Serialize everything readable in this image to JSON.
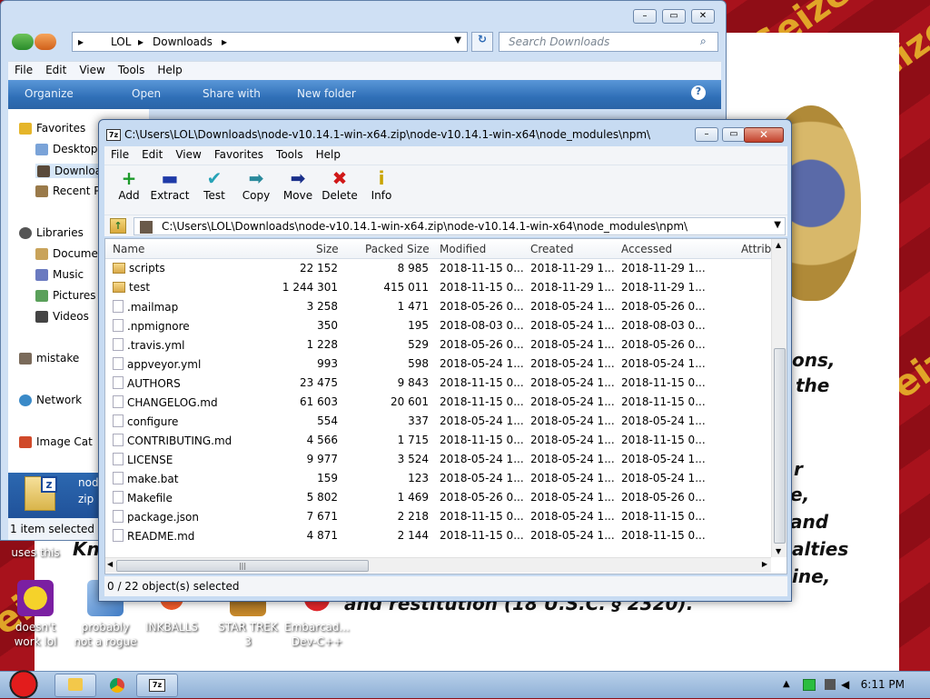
{
  "background": {
    "watermark_text": "Seized",
    "legal_lines": [
      "ons,",
      "the",
      "r",
      "e,",
      "and",
      "alties",
      "ine,",
      "and restitution (18 U.S.C. § 2320)."
    ],
    "partial_text_left": "Kn"
  },
  "desktop_icons": [
    {
      "label": "uses this"
    },
    {
      "label": "doesn't work lol"
    },
    {
      "label": "probably not a rogue"
    },
    {
      "label": "INKBALLS"
    },
    {
      "label": "STAR TREK 3"
    },
    {
      "label": "Embarcad... Dev-C++"
    }
  ],
  "explorer": {
    "breadcrumb": [
      "LOL",
      "Downloads"
    ],
    "search_placeholder": "Search Downloads",
    "menu": [
      "File",
      "Edit",
      "View",
      "Tools",
      "Help"
    ],
    "commands": [
      "Organize",
      "Open",
      "Share with",
      "New folder"
    ],
    "nav": [
      "Favorites",
      "Desktop",
      "Downloads",
      "Recent P",
      "Libraries",
      "Docume",
      "Music",
      "Pictures",
      "Videos",
      "mistake",
      "Network",
      "Image Cat"
    ],
    "detail_name": "node",
    "detail_type": "zip",
    "status": "1 item selected"
  },
  "zip": {
    "title": "C:\\Users\\LOL\\Downloads\\node-v10.14.1-win-x64.zip\\node-v10.14.1-win-x64\\node_modules\\npm\\",
    "menu": [
      "File",
      "Edit",
      "View",
      "Favorites",
      "Tools",
      "Help"
    ],
    "toolbar": [
      {
        "label": "Add",
        "glyph": "+",
        "color": "#1c9a2a"
      },
      {
        "label": "Extract",
        "glyph": "▬",
        "color": "#1e3aa8"
      },
      {
        "label": "Test",
        "glyph": "✔",
        "color": "#27a3b7"
      },
      {
        "label": "Copy",
        "glyph": "➡",
        "color": "#2a8a9c"
      },
      {
        "label": "Move",
        "glyph": "➡",
        "color": "#1a2f8a"
      },
      {
        "label": "Delete",
        "glyph": "✖",
        "color": "#d01818"
      },
      {
        "label": "Info",
        "glyph": "i",
        "color": "#c9a400"
      }
    ],
    "address": "C:\\Users\\LOL\\Downloads\\node-v10.14.1-win-x64.zip\\node-v10.14.1-win-x64\\node_modules\\npm\\",
    "columns": [
      "Name",
      "Size",
      "Packed Size",
      "Modified",
      "Created",
      "Accessed",
      "Attrib"
    ],
    "rows": [
      {
        "name": "scripts",
        "size": "22 152",
        "packed": "8 985",
        "modified": "2018-11-15 0...",
        "created": "2018-11-29 1...",
        "accessed": "2018-11-29 1...",
        "folder": true
      },
      {
        "name": "test",
        "size": "1 244 301",
        "packed": "415 011",
        "modified": "2018-11-15 0...",
        "created": "2018-11-29 1...",
        "accessed": "2018-11-29 1...",
        "folder": true
      },
      {
        "name": ".mailmap",
        "size": "3 258",
        "packed": "1 471",
        "modified": "2018-05-26 0...",
        "created": "2018-05-24 1...",
        "accessed": "2018-05-26 0...",
        "folder": false
      },
      {
        "name": ".npmignore",
        "size": "350",
        "packed": "195",
        "modified": "2018-08-03 0...",
        "created": "2018-05-24 1...",
        "accessed": "2018-08-03 0...",
        "folder": false
      },
      {
        "name": ".travis.yml",
        "size": "1 228",
        "packed": "529",
        "modified": "2018-05-26 0...",
        "created": "2018-05-24 1...",
        "accessed": "2018-05-26 0...",
        "folder": false
      },
      {
        "name": "appveyor.yml",
        "size": "993",
        "packed": "598",
        "modified": "2018-05-24 1...",
        "created": "2018-05-24 1...",
        "accessed": "2018-05-24 1...",
        "folder": false
      },
      {
        "name": "AUTHORS",
        "size": "23 475",
        "packed": "9 843",
        "modified": "2018-11-15 0...",
        "created": "2018-05-24 1...",
        "accessed": "2018-11-15 0...",
        "folder": false
      },
      {
        "name": "CHANGELOG.md",
        "size": "61 603",
        "packed": "20 601",
        "modified": "2018-11-15 0...",
        "created": "2018-05-24 1...",
        "accessed": "2018-11-15 0...",
        "folder": false
      },
      {
        "name": "configure",
        "size": "554",
        "packed": "337",
        "modified": "2018-05-24 1...",
        "created": "2018-05-24 1...",
        "accessed": "2018-05-24 1...",
        "folder": false
      },
      {
        "name": "CONTRIBUTING.md",
        "size": "4 566",
        "packed": "1 715",
        "modified": "2018-11-15 0...",
        "created": "2018-05-24 1...",
        "accessed": "2018-11-15 0...",
        "folder": false
      },
      {
        "name": "LICENSE",
        "size": "9 977",
        "packed": "3 524",
        "modified": "2018-05-24 1...",
        "created": "2018-05-24 1...",
        "accessed": "2018-05-24 1...",
        "folder": false
      },
      {
        "name": "make.bat",
        "size": "159",
        "packed": "123",
        "modified": "2018-05-24 1...",
        "created": "2018-05-24 1...",
        "accessed": "2018-05-24 1...",
        "folder": false
      },
      {
        "name": "Makefile",
        "size": "5 802",
        "packed": "1 469",
        "modified": "2018-05-26 0...",
        "created": "2018-05-24 1...",
        "accessed": "2018-05-26 0...",
        "folder": false
      },
      {
        "name": "package.json",
        "size": "7 671",
        "packed": "2 218",
        "modified": "2018-11-15 0...",
        "created": "2018-05-24 1...",
        "accessed": "2018-11-15 0...",
        "folder": false
      },
      {
        "name": "README.md",
        "size": "4 871",
        "packed": "2 144",
        "modified": "2018-11-15 0...",
        "created": "2018-05-24 1...",
        "accessed": "2018-11-15 0...",
        "folder": false
      }
    ],
    "status": "0 / 22 object(s) selected"
  },
  "taskbar": {
    "clock": "6:11 PM"
  }
}
